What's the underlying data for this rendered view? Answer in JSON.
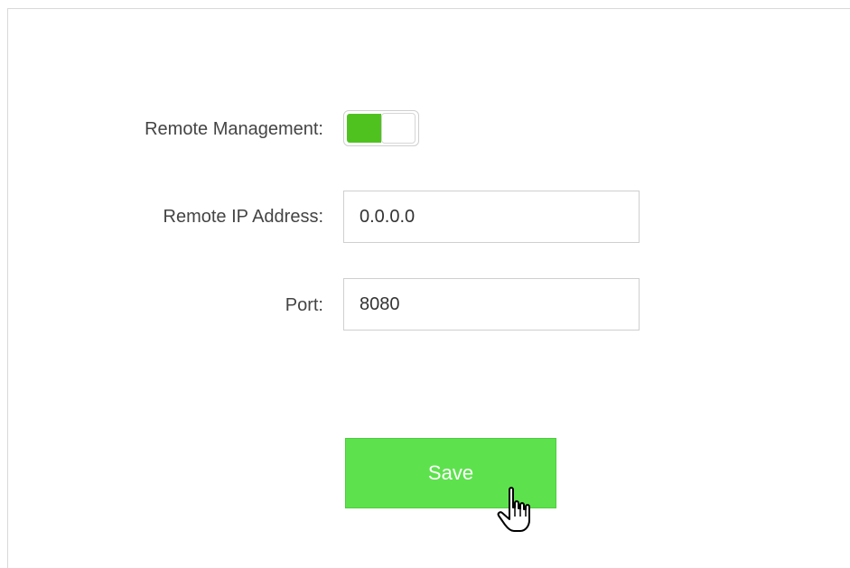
{
  "form": {
    "remote_management": {
      "label": "Remote Management:",
      "enabled": true,
      "on_color": "#50c21f"
    },
    "remote_ip": {
      "label": "Remote IP Address:",
      "value": "0.0.0.0"
    },
    "port": {
      "label": "Port:",
      "value": "8080"
    },
    "save_button": {
      "label": "Save",
      "color": "#5de24d"
    }
  },
  "cursor": {
    "icon": "hand-pointer-icon"
  }
}
